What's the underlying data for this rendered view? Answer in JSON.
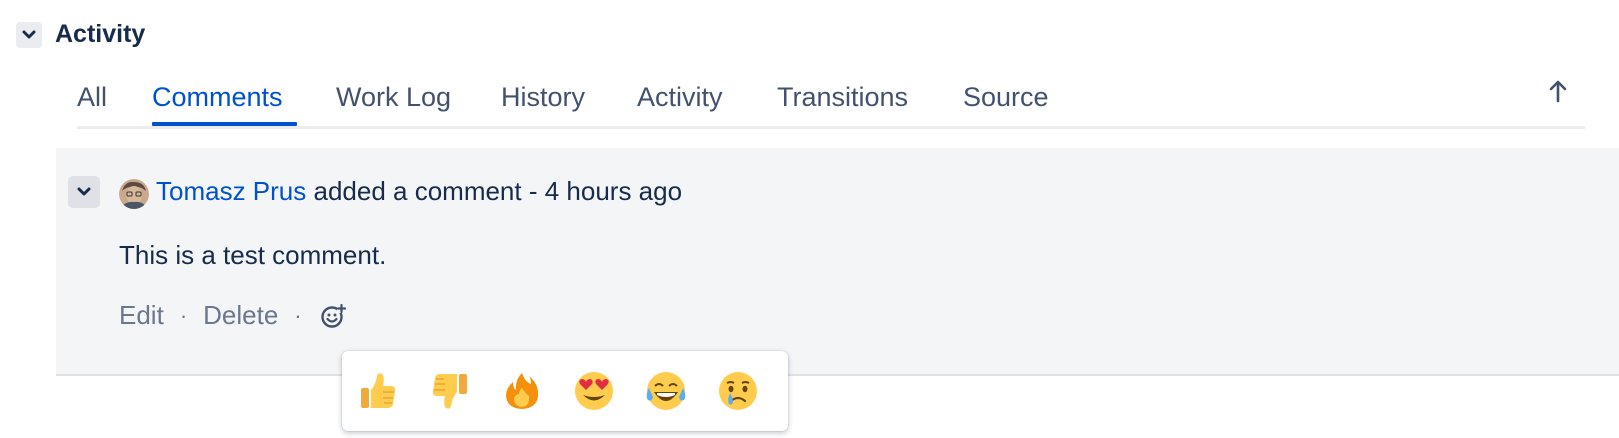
{
  "section": {
    "title": "Activity"
  },
  "tabs": [
    {
      "label": "All",
      "active": false
    },
    {
      "label": "Comments",
      "active": true
    },
    {
      "label": "Work Log",
      "active": false
    },
    {
      "label": "History",
      "active": false
    },
    {
      "label": "Activity",
      "active": false
    },
    {
      "label": "Transitions",
      "active": false
    },
    {
      "label": "Source",
      "active": false
    }
  ],
  "comment": {
    "author": "Tomasz Prus",
    "action_text": " added a comment - 4 hours ago",
    "body": "This is a test comment.",
    "actions": {
      "edit_label": "Edit",
      "delete_label": "Delete",
      "separator": "·"
    }
  },
  "reactions": [
    {
      "name": "thumbs-up",
      "icon": "thumbs-up-emoji"
    },
    {
      "name": "thumbs-down",
      "icon": "thumbs-down-emoji"
    },
    {
      "name": "fire",
      "icon": "fire-emoji"
    },
    {
      "name": "heart-eyes",
      "icon": "heart-eyes-emoji"
    },
    {
      "name": "tears-of-joy",
      "icon": "tears-of-joy-emoji"
    },
    {
      "name": "crying",
      "icon": "crying-emoji"
    }
  ],
  "colors": {
    "link": "#0052cc",
    "text": "#172b4d",
    "subtle": "#6b778c",
    "card_bg": "#f4f5f7"
  }
}
